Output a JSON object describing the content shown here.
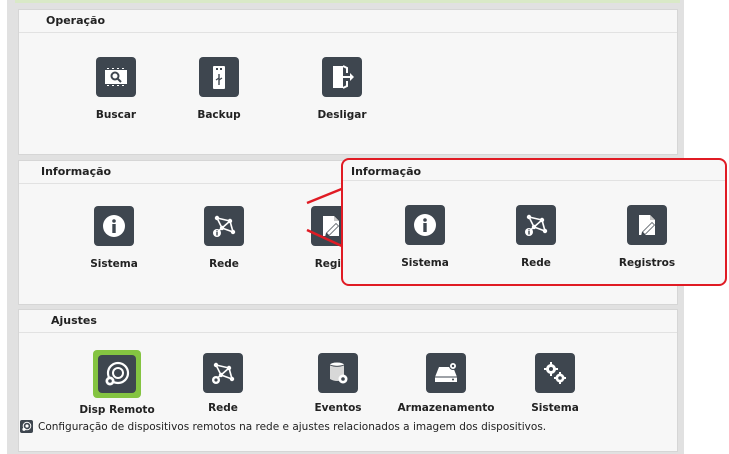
{
  "sections": {
    "operacao": {
      "title": "Operação",
      "items": [
        {
          "label": "Buscar",
          "icon": "search-video-icon"
        },
        {
          "label": "Backup",
          "icon": "usb-drive-icon"
        },
        {
          "label": "Desligar",
          "icon": "exit-door-icon"
        }
      ]
    },
    "informacao": {
      "title": "Informação",
      "items": [
        {
          "label": "Sistema",
          "icon": "info-icon"
        },
        {
          "label": "Rede",
          "icon": "network-info-icon"
        },
        {
          "label": "Regis",
          "icon": "log-edit-icon"
        }
      ]
    },
    "ajustes": {
      "title": "Ajustes",
      "items": [
        {
          "label": "Disp Remoto",
          "icon": "remote-camera-icon",
          "selected": true
        },
        {
          "label": "Rede",
          "icon": "network-icon"
        },
        {
          "label": "Eventos",
          "icon": "events-icon"
        },
        {
          "label": "Armazenamento",
          "icon": "storage-icon"
        },
        {
          "label": "Sistema",
          "icon": "system-gears-icon"
        }
      ],
      "description": "Configuração de dispositivos remotos na rede e ajustes relacionados a imagem dos dispositivos."
    }
  },
  "callout": {
    "title": "Informação",
    "items": [
      {
        "label": "Sistema",
        "icon": "info-icon"
      },
      {
        "label": "Rede",
        "icon": "network-info-icon"
      },
      {
        "label": "Registros",
        "icon": "log-edit-icon"
      }
    ]
  },
  "colors": {
    "highlight": "#e01b24",
    "selected": "#84c441",
    "icon_bg": "#3e464f"
  }
}
